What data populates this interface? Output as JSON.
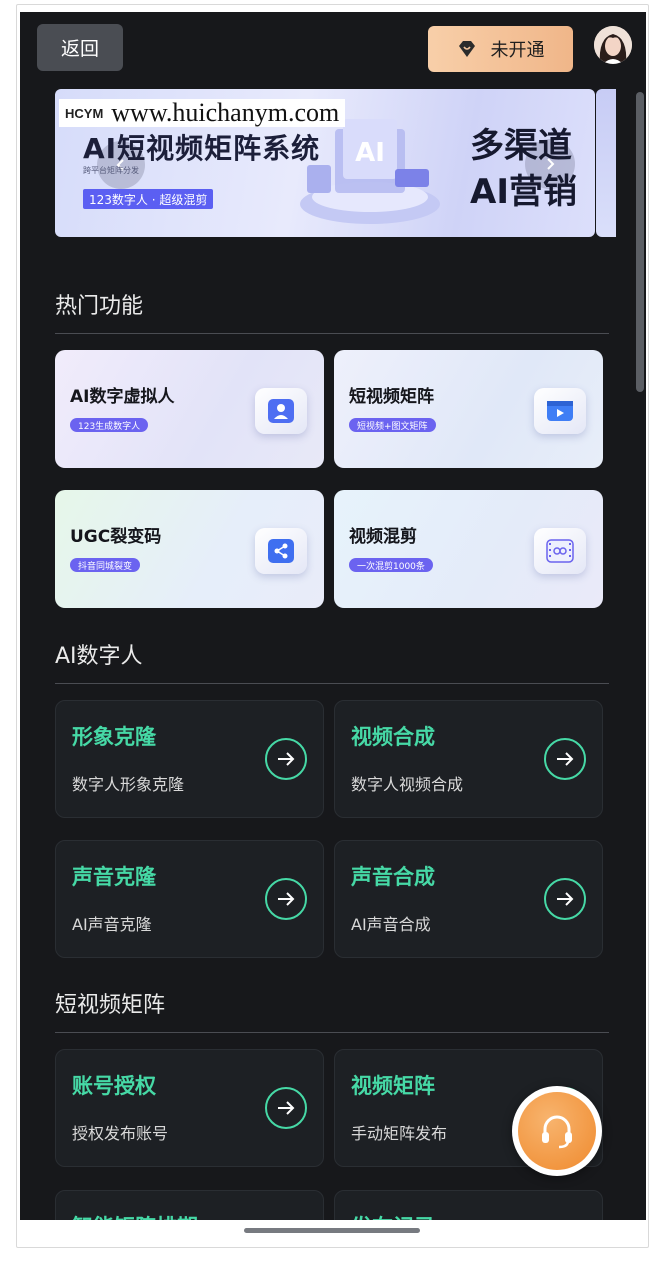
{
  "header": {
    "back_label": "返回",
    "vip_label": "未开通"
  },
  "banner": {
    "watermark_logo": "HCYM",
    "watermark_url": "www.huichanym.com",
    "title": "AI短视频矩阵系统",
    "subtitle": "跨平台矩阵分发",
    "tag": "123数字人 · 超级混剪",
    "right_line1": "多渠道",
    "right_line2": "AI营销"
  },
  "sections": {
    "hot": "热门功能",
    "ai_person": "AI数字人",
    "short_video": "短视频矩阵"
  },
  "hot_cards": [
    {
      "title": "AI数字虚拟人",
      "tag": "123生成数字人"
    },
    {
      "title": "短视频矩阵",
      "tag": "短视频+图文矩阵"
    },
    {
      "title": "UGC裂变码",
      "tag": "抖音同城裂变"
    },
    {
      "title": "视频混剪",
      "tag": "一次混剪1000条"
    }
  ],
  "ai_cards": [
    {
      "title": "形象克隆",
      "sub": "数字人形象克隆"
    },
    {
      "title": "视频合成",
      "sub": "数字人视频合成"
    },
    {
      "title": "声音克隆",
      "sub": "AI声音克隆"
    },
    {
      "title": "声音合成",
      "sub": "AI声音合成"
    }
  ],
  "matrix_cards": [
    {
      "title": "账号授权",
      "sub": "授权发布账号"
    },
    {
      "title": "视频矩阵",
      "sub": "手动矩阵发布"
    },
    {
      "title": "智能矩阵排期",
      "sub": ""
    },
    {
      "title": "发布记录",
      "sub": ""
    }
  ],
  "colors": {
    "background": "#17181b",
    "accent_green": "#46d9a6",
    "vip_gold": "#f0b689",
    "fab_orange": "#ef8a2e"
  }
}
